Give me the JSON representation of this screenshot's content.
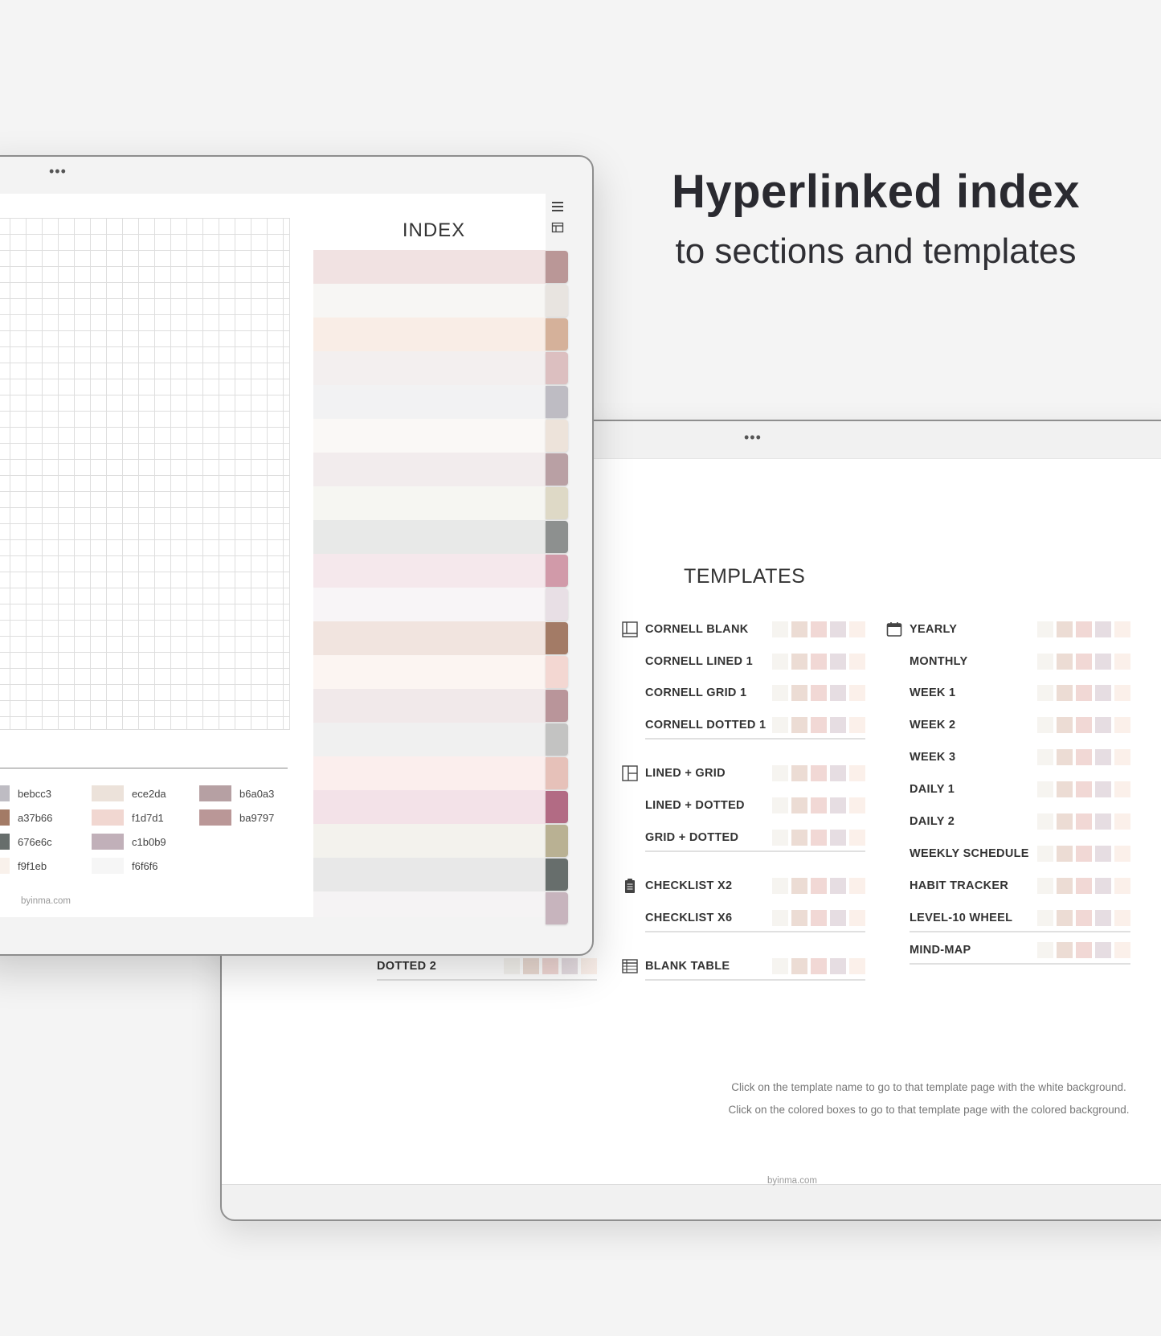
{
  "headline": {
    "title": "Hyperlinked index",
    "subtitle": "to sections and templates"
  },
  "front_tablet": {
    "menu_dots": "•••",
    "index_title": "INDEX",
    "footer": "byinma.com",
    "icons": [
      "hamburger-menu-icon",
      "table-icon"
    ],
    "index_band_colors": [
      "#f1e2e2",
      "#f7f6f4",
      "#f9ede6",
      "#f3efef",
      "#f2f2f3",
      "#faf8f6",
      "#f2eced",
      "#f6f6f2",
      "#e8e9e8",
      "#f5e8ec",
      "#f8f5f7",
      "#f1e4df",
      "#fcf5f2",
      "#f1e9ea",
      "#f0f0f0",
      "#fbeeed",
      "#f3e2e8",
      "#f3f2ed",
      "#e8e8e8",
      "#f5f3f4"
    ],
    "tab_colors": [
      "#ba9797",
      "#e8e4e0",
      "#d5b19a",
      "#dcbfc0",
      "#bebcc3",
      "#ede3da",
      "#b9a0a4",
      "#ded9c6",
      "#8d908f",
      "#d19aa9",
      "#e8dfe5",
      "#a37b66",
      "#f3d7d2",
      "#b9959a",
      "#c3c3c2",
      "#e6c1b9",
      "#b26b84",
      "#b9b193",
      "#676e6c",
      "#c7b4bd"
    ],
    "palette": [
      {
        "hex": "bebcc3",
        "color": "#bebcc3"
      },
      {
        "hex": "a37b66",
        "color": "#a37b66"
      },
      {
        "hex": "676e6c",
        "color": "#676e6c"
      },
      {
        "hex": "f9f1eb",
        "color": "#f9f1eb"
      },
      {
        "hex": "ece2da",
        "color": "#ece2da"
      },
      {
        "hex": "f1d7d1",
        "color": "#f1d7d1"
      },
      {
        "hex": "c1b0b9",
        "color": "#c1b0b9"
      },
      {
        "hex": "f6f6f6",
        "color": "#f6f6f6"
      },
      {
        "hex": "b6a0a3",
        "color": "#b6a0a3"
      },
      {
        "hex": "ba9797",
        "color": "#ba9797"
      }
    ]
  },
  "back_tablet": {
    "menu_dots": "•••",
    "title": "TEMPLATES",
    "swatch_colors": [
      "#f6f4f0",
      "#ecdcd4",
      "#f1d8d5",
      "#e6dde2",
      "#fbf0ea"
    ],
    "left_column": [
      {
        "label": "CORNELL BLANK",
        "icon": "cornell-icon"
      },
      {
        "label": "CORNELL LINED 1"
      },
      {
        "label": "CORNELL GRID 1"
      },
      {
        "label": "CORNELL DOTTED 1"
      },
      {
        "label": "LINED + GRID",
        "icon": "grid-layout-icon"
      },
      {
        "label": "LINED + DOTTED"
      },
      {
        "label": "GRID + DOTTED"
      },
      {
        "label": "CHECKLIST X2",
        "icon": "clipboard-icon"
      },
      {
        "label": "CHECKLIST X6"
      },
      {
        "label": "BLANK TABLE",
        "icon": "table-grid-icon"
      }
    ],
    "right_column": [
      {
        "label": "YEARLY",
        "icon": "calendar-icon"
      },
      {
        "label": "MONTHLY"
      },
      {
        "label": "WEEK 1"
      },
      {
        "label": "WEEK 2"
      },
      {
        "label": "WEEK 3"
      },
      {
        "label": "DAILY 1"
      },
      {
        "label": "DAILY 2"
      },
      {
        "label": "WEEKLY SCHEDULE"
      },
      {
        "label": "HABIT TRACKER"
      },
      {
        "label": "LEVEL-10 WHEEL"
      },
      {
        "label": "MIND-MAP"
      }
    ],
    "hidden_row": {
      "label": "DOTTED 2"
    },
    "notes": [
      "Click on the template name to go to that template page with the white background.",
      "Click on the colored boxes to go to that template page with the colored background."
    ],
    "footer": "byinma.com"
  }
}
